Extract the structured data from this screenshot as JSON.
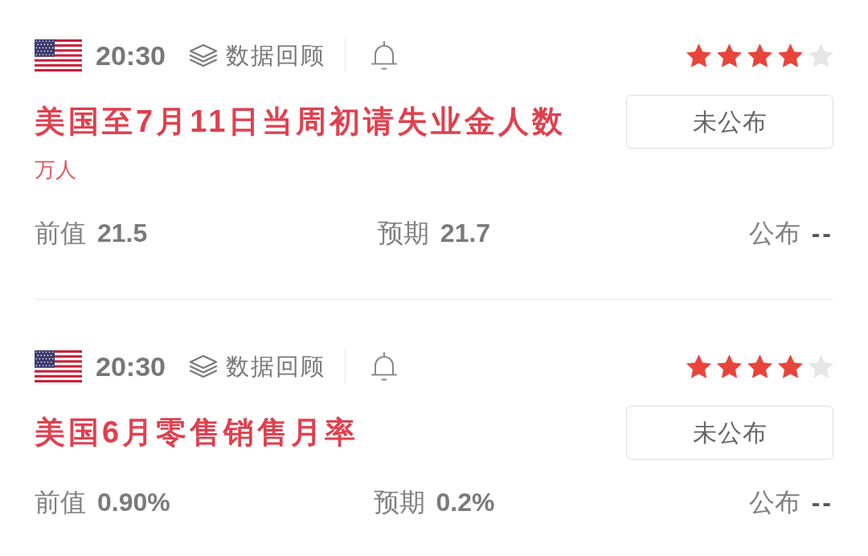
{
  "events": [
    {
      "time": "20:30",
      "review": "数据回顾",
      "stars": 4,
      "title": "美国至7月11日当周初请失业金人数",
      "unit": "万人",
      "status": "未公布",
      "previous": {
        "label": "前值",
        "value": "21.5"
      },
      "forecast": {
        "label": "预期",
        "value": "21.7"
      },
      "actual": {
        "label": "公布",
        "value": "--"
      }
    },
    {
      "time": "20:30",
      "review": "数据回顾",
      "stars": 4,
      "title": "美国6月零售销售月率",
      "status": "未公布",
      "previous": {
        "label": "前值",
        "value": "0.90%"
      },
      "forecast": {
        "label": "预期",
        "value": "0.2%"
      },
      "actual": {
        "label": "公布",
        "value": "--"
      }
    }
  ]
}
